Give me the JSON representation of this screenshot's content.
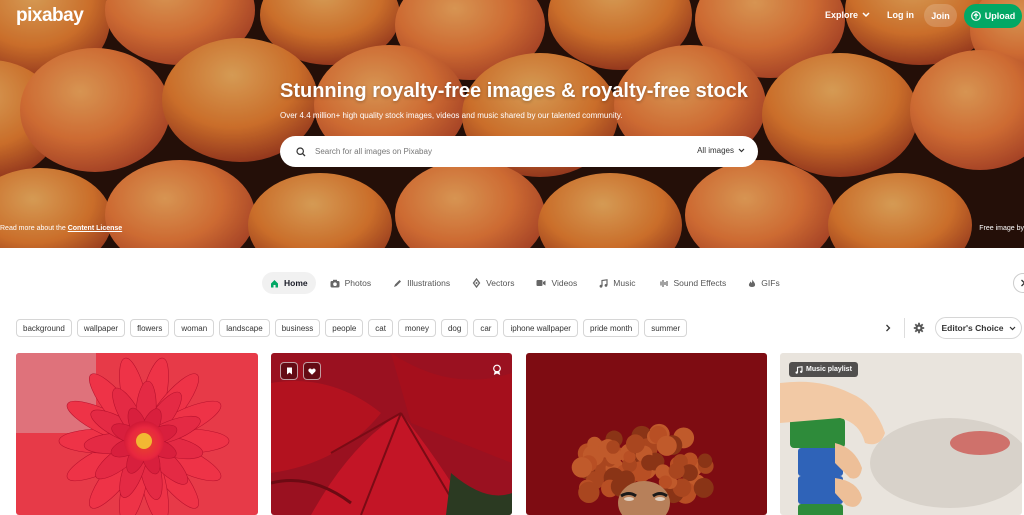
{
  "brand": {
    "logo_text": "pixabay"
  },
  "nav": {
    "explore_label": "Explore",
    "login_label": "Log in",
    "join_label": "Join",
    "upload_label": "Upload"
  },
  "hero": {
    "title": "Stunning royalty-free images & royalty-free stock",
    "subtitle": "Over 4.4 million+ high quality stock images, videos and music shared by our talented community.",
    "license_prefix": "Read more about the ",
    "license_link": "Content License",
    "free_image_text": "Free image by"
  },
  "search": {
    "placeholder": "Search for all images on Pixabay",
    "filter_label": "All images"
  },
  "tabs": [
    {
      "label": "Home",
      "icon": "home-icon",
      "active": true
    },
    {
      "label": "Photos",
      "icon": "camera-icon"
    },
    {
      "label": "Illustrations",
      "icon": "pen-icon"
    },
    {
      "label": "Vectors",
      "icon": "vector-icon"
    },
    {
      "label": "Videos",
      "icon": "video-icon"
    },
    {
      "label": "Music",
      "icon": "music-icon"
    },
    {
      "label": "Sound Effects",
      "icon": "waveform-icon"
    },
    {
      "label": "GIFs",
      "icon": "gif-icon"
    }
  ],
  "chips": [
    "background",
    "wallpaper",
    "flowers",
    "woman",
    "landscape",
    "business",
    "people",
    "cat",
    "money",
    "dog",
    "car",
    "iphone wallpaper",
    "pride month",
    "summer"
  ],
  "sort": {
    "label": "Editor's Choice"
  },
  "cards": {
    "playlist_label": "Music playlist"
  },
  "colors": {
    "accent": "#02a865",
    "hero_fruit": "#f08a3c",
    "card_red": "#b3121f"
  }
}
